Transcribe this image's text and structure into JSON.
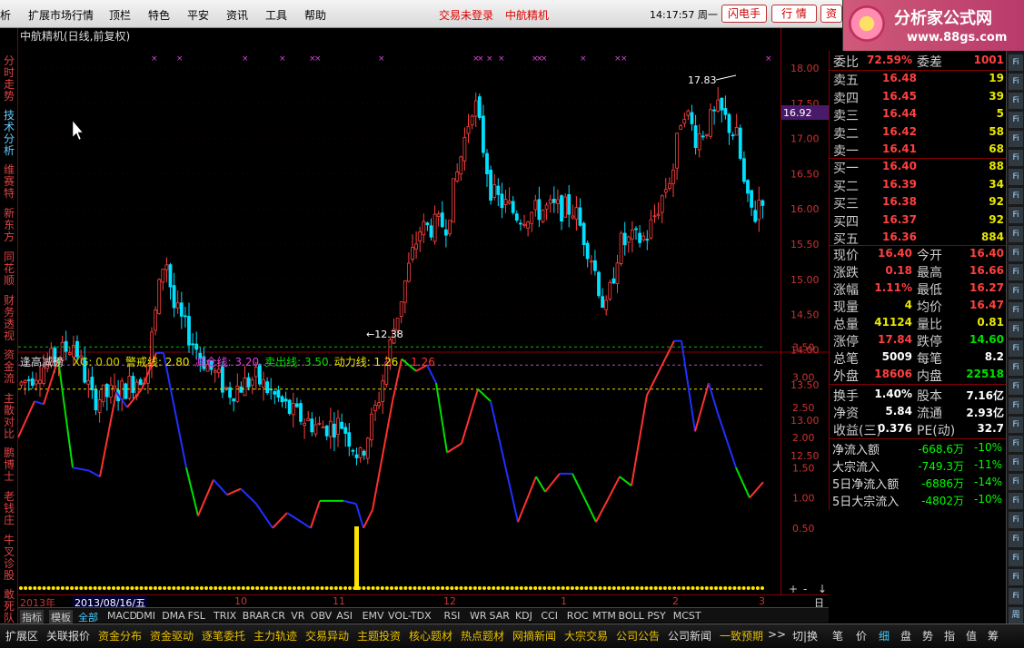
{
  "menu": [
    "析",
    "扩展市场行情",
    "顶栏",
    "特色",
    "平安",
    "资讯",
    "工具",
    "帮助"
  ],
  "status": {
    "login": "交易未登录",
    "stock": "中航精机",
    "time": "14:17:57",
    "weekday": "周一"
  },
  "top_buttons": [
    "闪电手",
    "行 情",
    "资"
  ],
  "logo": {
    "title": "分析家公式网",
    "url": "www.88gs.com"
  },
  "left_tabs": [
    "分时走势",
    "技术分析",
    "维赛特",
    "新东方",
    "同花顺",
    "财务透视",
    "资金流",
    "主散对比",
    "鹏博士",
    "老钱庄",
    "牛叉诊股",
    "敢死队"
  ],
  "chart": {
    "title": "中航精机(日线,前复权)",
    "price_labels": [
      "18.00",
      "17.50",
      "17.00",
      "16.50",
      "16.00",
      "15.50",
      "15.00",
      "14.50",
      "14.00",
      "13.50",
      "13.00",
      "12.50"
    ],
    "current_price_tag": "16.92",
    "high_label": "17.83",
    "low_label": "12.38",
    "ind_labels": [
      "3.50",
      "3.00",
      "2.50",
      "2.00",
      "1.50",
      "1.00",
      "0.50"
    ]
  },
  "indicator": {
    "name": "逢高减磅",
    "items": [
      {
        "label": "XG: 0.00",
        "color": "#d0d000"
      },
      {
        "label": "警戒线: 2.80",
        "color": "#e8e800"
      },
      {
        "label": "减仓线: 3.20",
        "color": "#e040e0"
      },
      {
        "label": "卖出线: 3.50",
        "color": "#00e000"
      },
      {
        "label": "动力线: 1.26",
        "color": "#e8e800"
      },
      {
        "label": ": 1.26",
        "color": "#ff3030"
      }
    ]
  },
  "dates": {
    "selected": "2013/08/16/五",
    "year": "2013年",
    "months": [
      "10",
      "11",
      "12",
      "1",
      "2",
      "3"
    ],
    "period": "日线"
  },
  "indicator_tabs": [
    "指标",
    "模板",
    "全部",
    "MACD",
    "DMI",
    "DMA",
    "FSL",
    "TRIX",
    "BRAR",
    "CR",
    "VR",
    "OBV",
    "ASI",
    "EMV",
    "VOL-TDX",
    "RSI",
    "WR",
    "SAR",
    "KDJ",
    "CCI",
    "ROC",
    "MTM",
    "BOLL",
    "PSY",
    "MCST"
  ],
  "bottom_tabs": [
    "扩展区",
    "关联报价",
    "资金分布",
    "资金驱动",
    "逐笔委托",
    "主力轨迹",
    "交易异动",
    "主题投资",
    "核心题材",
    "热点题材",
    "网摘新闻",
    "大宗交易",
    "公司公告",
    "公司新闻",
    "一致预期"
  ],
  "bottom_right": [
    "切|换",
    "笔",
    "价",
    "细",
    "盘",
    "势",
    "指",
    "值",
    "筹"
  ],
  "quote": {
    "header": {
      "l1": "委比",
      "v1": "72.59%",
      "l2": "委差",
      "v2": "1001"
    },
    "asks": [
      {
        "label": "卖五",
        "price": "16.48",
        "vol": "19"
      },
      {
        "label": "卖四",
        "price": "16.45",
        "vol": "39"
      },
      {
        "label": "卖三",
        "price": "16.44",
        "vol": "5"
      },
      {
        "label": "卖二",
        "price": "16.42",
        "vol": "58"
      },
      {
        "label": "卖一",
        "price": "16.41",
        "vol": "68"
      }
    ],
    "bids": [
      {
        "label": "买一",
        "price": "16.40",
        "vol": "88"
      },
      {
        "label": "买二",
        "price": "16.39",
        "vol": "34"
      },
      {
        "label": "买三",
        "price": "16.38",
        "vol": "92"
      },
      {
        "label": "买四",
        "price": "16.37",
        "vol": "92"
      },
      {
        "label": "买五",
        "price": "16.36",
        "vol": "884"
      }
    ],
    "stats": [
      {
        "l1": "现价",
        "v1": "16.40",
        "c1": "up",
        "l2": "今开",
        "v2": "16.40",
        "c2": "up"
      },
      {
        "l1": "涨跌",
        "v1": "0.18",
        "c1": "up",
        "l2": "最高",
        "v2": "16.66",
        "c2": "up"
      },
      {
        "l1": "涨幅",
        "v1": "1.11%",
        "c1": "up",
        "l2": "最低",
        "v2": "16.27",
        "c2": "up"
      },
      {
        "l1": "现量",
        "v1": "4",
        "c1": "yl",
        "l2": "均价",
        "v2": "16.47",
        "c2": "up"
      },
      {
        "l1": "总量",
        "v1": "41124",
        "c1": "yl",
        "l2": "量比",
        "v2": "0.81",
        "c2": "yl"
      },
      {
        "l1": "涨停",
        "v1": "17.84",
        "c1": "up",
        "l2": "跌停",
        "v2": "14.60",
        "c2": "dn"
      },
      {
        "l1": "总笔",
        "v1": "5009",
        "c1": "wh",
        "l2": "每笔",
        "v2": "8.2",
        "c2": "wh"
      },
      {
        "l1": "外盘",
        "v1": "18606",
        "c1": "up",
        "l2": "内盘",
        "v2": "22518",
        "c2": "dn"
      }
    ],
    "fund": [
      {
        "l1": "换手",
        "v1": "1.40%",
        "l2": "股本",
        "v2": "7.16亿"
      },
      {
        "l1": "净资",
        "v1": "5.84",
        "l2": "流通",
        "v2": "2.93亿"
      },
      {
        "l1": "收益(三)",
        "v1": "0.376",
        "l2": "PE(动)",
        "v2": "32.7"
      }
    ]
  },
  "flow": [
    {
      "label": "净流入额",
      "value": "-668.6万",
      "pct": "-10%"
    },
    {
      "label": "大宗流入",
      "value": "-749.3万",
      "pct": "-11%"
    },
    {
      "label": "5日净流入额",
      "value": "-6886万",
      "pct": "-14%"
    },
    {
      "label": "5日大宗流入",
      "value": "-4802万",
      "pct": "-10%"
    }
  ],
  "right_strip": [
    "Fi",
    "Fi",
    "Fi",
    "Fi",
    "Fi",
    "Fi",
    "Fi",
    "Fi",
    "Fi",
    "Fi",
    "Fi",
    "Fi",
    "Fi",
    "Fi",
    "Fi",
    "Fi",
    "Fi",
    "Fi",
    "Fi",
    "Fi",
    "Fi",
    "Fi",
    "Fi",
    "Fi",
    "Fi",
    "Fi",
    "Fi",
    "Fi",
    "Fi",
    "周"
  ],
  "colors": {
    "up": "#ff4040",
    "down": "#00e0ff",
    "accent_red": "#c00000"
  }
}
